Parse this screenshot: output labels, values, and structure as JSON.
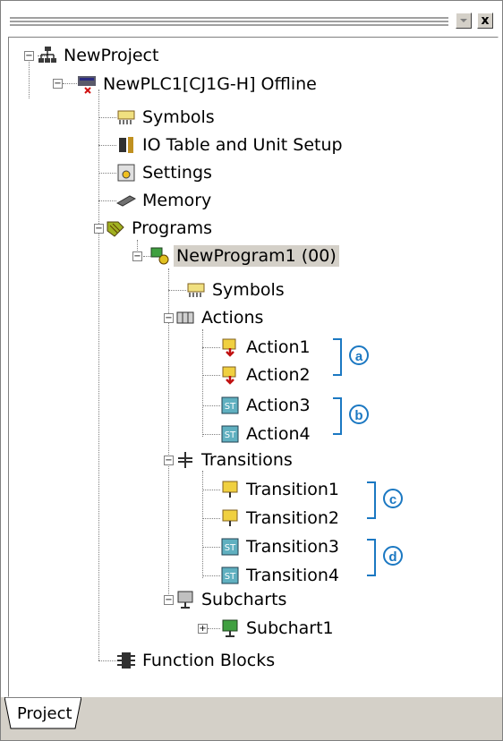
{
  "window": {
    "close_label": "x"
  },
  "tree": {
    "root": "NewProject",
    "plc": "NewPLC1[CJ1G-H] Offline",
    "plc_children": [
      "Symbols",
      "IO Table and Unit Setup",
      "Settings",
      "Memory",
      "Programs",
      "Function Blocks"
    ],
    "program": "NewProgram1 (00)",
    "program_children": [
      "Symbols",
      "Actions",
      "Transitions",
      "Subcharts"
    ],
    "actions": [
      "Action1",
      "Action2",
      "Action3",
      "Action4"
    ],
    "transitions": [
      "Transition1",
      "Transition2",
      "Transition3",
      "Transition4"
    ],
    "subcharts": [
      "Subchart1"
    ],
    "expander_minus": "−",
    "expander_plus": "+"
  },
  "callouts": [
    "a",
    "b",
    "c",
    "d"
  ],
  "tabs": {
    "project": "Project"
  },
  "colors": {
    "callout": "#1b78c2",
    "selection": "#d4d0c8"
  },
  "icons": {
    "root": "network-icon",
    "plc": "plc-offline-icon",
    "symbols": "symbols-icon",
    "io_table": "io-table-icon",
    "settings": "settings-icon",
    "memory": "memory-icon",
    "programs": "programs-icon",
    "program": "program-icon",
    "actions": "actions-folder-icon",
    "ladder_action": "ladder-action-icon",
    "st": "st-icon",
    "transitions": "transitions-folder-icon",
    "transition": "transition-icon",
    "subcharts": "subcharts-icon",
    "subchart": "subchart-icon",
    "function_blocks": "function-blocks-icon"
  }
}
